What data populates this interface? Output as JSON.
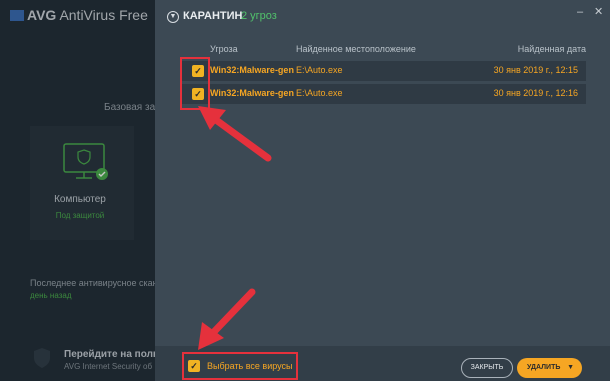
{
  "background": {
    "app_title_brand": "AVG",
    "app_title_rest": "AntiVirus Free",
    "section_label": "Базовая защ",
    "card_label": "Компьютер",
    "card_status": "Под защитой",
    "last_scan_label": "Последнее антивирусное скани",
    "last_scan_days": "день назад",
    "upgrade_title": "Перейдите на полну",
    "upgrade_sub": "AVG Internet Security об"
  },
  "header": {
    "title": "КАРАНТИН",
    "count": "2 угроз"
  },
  "columns": {
    "threat": "Угроза",
    "location": "Найденное местоположение",
    "date": "Найденная дата"
  },
  "rows": [
    {
      "threat": "Win32:Malware-gen",
      "location": "E:\\Auto.exe",
      "date": "30 янв 2019 г., 12:15"
    },
    {
      "threat": "Win32:Malware-gen",
      "location": "E:\\Auto.exe",
      "date": "30 янв 2019 г., 12:16"
    }
  ],
  "footer": {
    "select_all_label": "Выбрать все вирусы",
    "close_label": "ЗАКРЫТЬ",
    "delete_label": "УДАЛИТЬ"
  },
  "window": {
    "minimize_icon": "minimize-icon",
    "close_icon": "close-icon"
  },
  "colors": {
    "accent": "#f6a623",
    "green": "#51c16b",
    "annotation_red": "#e5313c"
  }
}
